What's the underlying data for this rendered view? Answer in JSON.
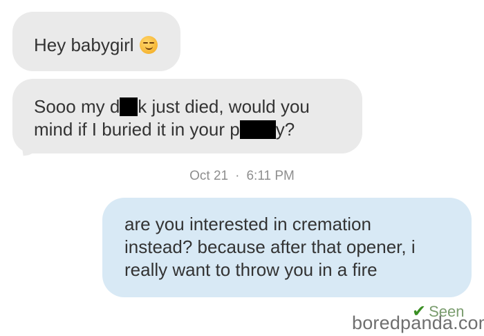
{
  "messages": [
    {
      "direction": "incoming",
      "text": "Hey babygirl",
      "emoji": "smirking-face"
    },
    {
      "direction": "incoming",
      "line1_a": "Sooo my d",
      "line1_b": "k just died, would you",
      "line2_a": "mind if I buried it in your p",
      "line2_b": "y?"
    },
    {
      "direction": "outgoing",
      "line1": "are you interested in cremation",
      "line2": "instead? because after that opener, i",
      "line3": "really want to throw you in a fire"
    }
  ],
  "timestamp": {
    "date": "Oct 21",
    "separator": "·",
    "time": "6:11 PM"
  },
  "status": {
    "label": "Seen",
    "icon": "check-icon"
  },
  "watermark": "boredpanda.com",
  "colors": {
    "incoming_bubble": "#eaeaea",
    "outgoing_bubble": "#d8e9f5",
    "timestamp": "#8e8e8e",
    "seen_check": "#3a8f23",
    "redaction": "#000000"
  }
}
